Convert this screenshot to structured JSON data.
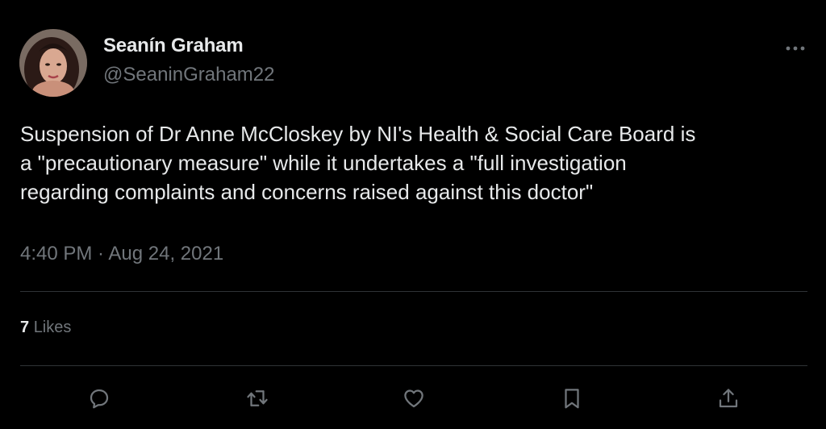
{
  "tweet": {
    "author_name": "Seanín Graham",
    "author_handle": "@SeaninGraham22",
    "text": "Suspension of Dr Anne McCloskey by NI's Health & Social Care Board is\na \"precautionary measure\" while it undertakes a \"full investigation\nregarding complaints and concerns raised against this doctor\"",
    "timestamp": "4:40 PM · Aug 24, 2021",
    "likes_count": "7",
    "likes_label": "Likes"
  },
  "icons": {
    "more": "more-icon",
    "reply": "reply-icon",
    "retweet": "retweet-icon",
    "like": "heart-icon",
    "bookmark": "bookmark-icon",
    "share": "share-icon"
  },
  "colors": {
    "background": "#000000",
    "primary_text": "#e7e9ea",
    "secondary_text": "#71767b",
    "divider": "#2f3336"
  }
}
